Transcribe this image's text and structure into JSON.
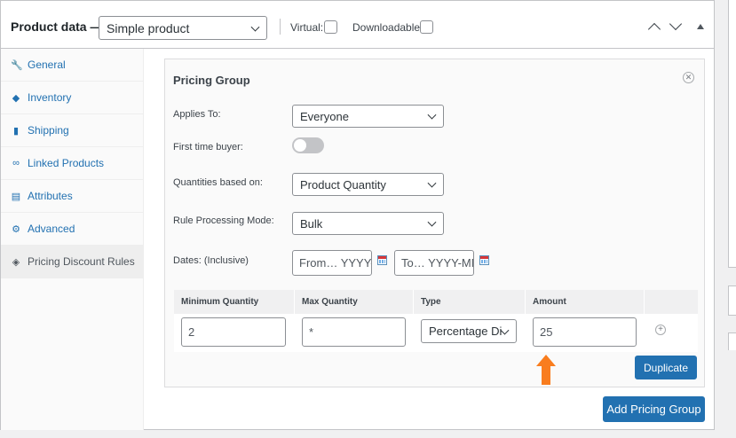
{
  "header": {
    "title": "Product data —",
    "product_type": "Simple product",
    "virtual_label": "Virtual:",
    "downloadable_label": "Downloadable:",
    "virtual_checked": false,
    "downloadable_checked": false
  },
  "sidebar": {
    "items": [
      {
        "label": "General",
        "icon": "wrench-icon",
        "active": false
      },
      {
        "label": "Inventory",
        "icon": "tag-diamond-icon",
        "active": false
      },
      {
        "label": "Shipping",
        "icon": "truck-icon",
        "active": false
      },
      {
        "label": "Linked Products",
        "icon": "link-icon",
        "active": false
      },
      {
        "label": "Attributes",
        "icon": "list-table-icon",
        "active": false
      },
      {
        "label": "Advanced",
        "icon": "gear-icon",
        "active": false
      },
      {
        "label": "Pricing Discount Rules",
        "icon": "price-tag-icon",
        "active": true
      }
    ]
  },
  "pricing_group": {
    "title": "Pricing Group",
    "applies_to_label": "Applies To:",
    "applies_to_value": "Everyone",
    "first_time_buyer_label": "First time buyer:",
    "first_time_buyer_on": false,
    "quantities_label": "Quantities based on:",
    "quantities_value": "Product Quantity",
    "mode_label": "Rule Processing Mode:",
    "mode_value": "Bulk",
    "dates_label": "Dates: (Inclusive)",
    "date_from_placeholder": "From… YYYY-",
    "date_to_placeholder": "To… YYYY-MM",
    "table": {
      "headers": [
        "Minimum Quantity",
        "Max Quantity",
        "Type",
        "Amount"
      ],
      "row": {
        "min": "2",
        "max": "*",
        "type": "Percentage Di",
        "amount": "25"
      }
    },
    "duplicate_label": "Duplicate"
  },
  "add_group_label": "Add Pricing Group",
  "colors": {
    "accent": "#2271b1",
    "arrow": "#f97d1e"
  }
}
